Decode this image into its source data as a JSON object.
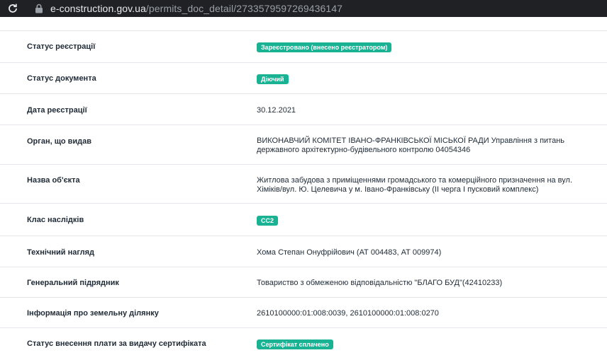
{
  "browser": {
    "url_domain": "e-construction.gov.ua",
    "url_path": "/permits_doc_detail/2733579597269436147"
  },
  "details": [
    {
      "label": "Статус реєстрації",
      "value": "Зареєстровано (внесено реєстратором)",
      "badge": true
    },
    {
      "label": "Статус документа",
      "value": "Діючий",
      "badge": true
    },
    {
      "label": "Дата реєстрації",
      "value": "30.12.2021",
      "badge": false
    },
    {
      "label": "Орган, що видав",
      "value": "ВИКОНАВЧИЙ КОМІТЕТ ІВАНО-ФРАНКІВСЬКОЇ МІСЬКОЇ РАДИ Управління з питань державного архітектурно-будівельного контролю 04054346",
      "badge": false
    },
    {
      "label": "Назва об'єкта",
      "value": "Житлова забудова з приміщеннями громадського та комерційного призначення на вул. Хіміків/вул. Ю. Целевича у м. Івано-Франківську (ІІ черга І пусковий комплекс)",
      "badge": false
    },
    {
      "label": "Клас наслідків",
      "value": "СС2",
      "badge": true
    },
    {
      "label": "Технічний нагляд",
      "value": "Хома Степан Онуфрійович (АТ 004483, АТ 009974)",
      "badge": false
    },
    {
      "label": "Генеральний підрядник",
      "value": "Товариство з обмеженою відповідальністю \"БЛАГО БУД\"(42410233)",
      "badge": false
    },
    {
      "label": "Інформація про земельну ділянку",
      "value": "2610100000:01:008:0039, 2610100000:01:008:0270",
      "badge": false
    },
    {
      "label": "Статус внесення плати за видачу сертифіката",
      "value": "Сертифікат сплачено",
      "badge": true
    }
  ],
  "colors": {
    "badge_bg": "#19b394",
    "text": "#1f2a36",
    "divider": "#e3e6ea",
    "browser_bar": "#202124"
  },
  "icons": {
    "reload": "reload-icon",
    "lock": "lock-icon"
  }
}
